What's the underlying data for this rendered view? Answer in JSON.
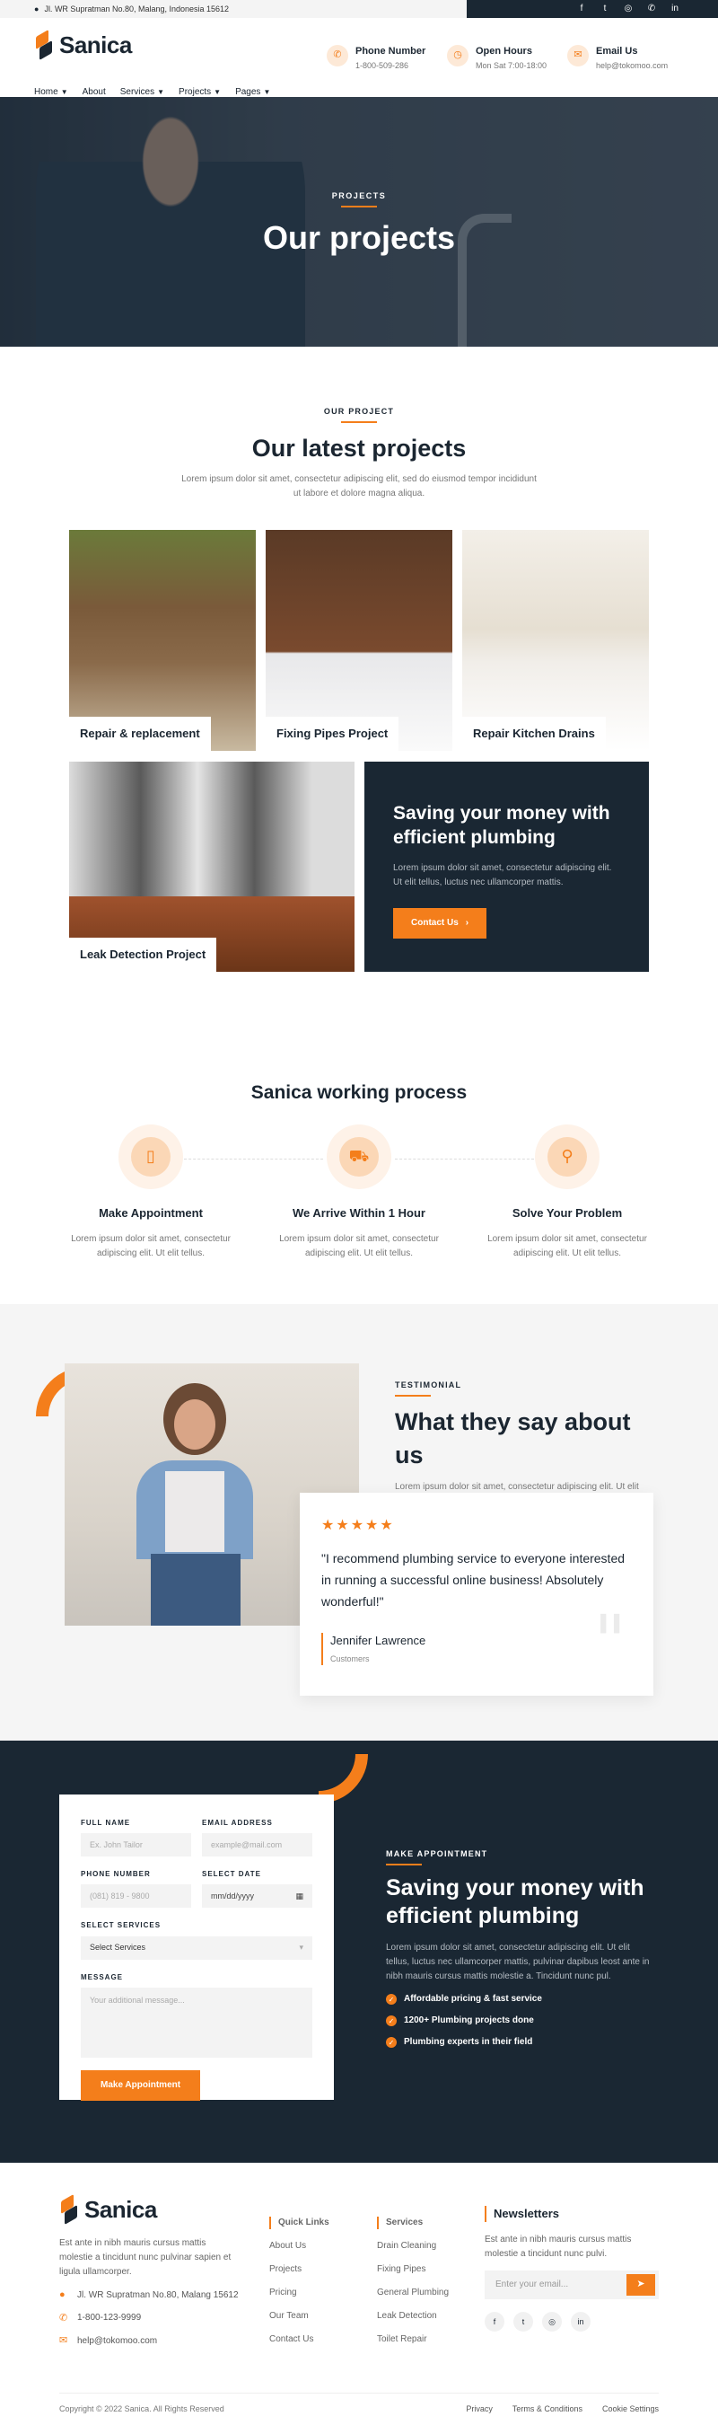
{
  "topbar": {
    "address": "Jl. WR Supratman No.80, Malang, Indonesia 15612"
  },
  "social": [
    "facebook-icon",
    "twitter-icon",
    "instagram-icon",
    "whatsapp-icon",
    "linkedin-icon"
  ],
  "brand": {
    "name": "Sanica",
    "accent": "#f47e1b",
    "dark": "#1a2733"
  },
  "nav": [
    "Home",
    "About",
    "Services",
    "Projects",
    "Pages"
  ],
  "header_info": [
    {
      "title": "Phone Number",
      "sub": "1-800-509-286"
    },
    {
      "title": "Open Hours",
      "sub": "Mon Sat 7:00-18:00"
    },
    {
      "title": "Email Us",
      "sub": "help@tokomoo.com"
    }
  ],
  "hero": {
    "label": "PROJECTS",
    "title": "Our projects"
  },
  "latest": {
    "kicker": "OUR PROJECT",
    "title": "Our latest projects",
    "desc": "Lorem ipsum dolor sit amet, consectetur adipiscing elit, sed do eiusmod tempor incididunt ut labore et dolore magna aliqua.",
    "projects": [
      "Repair & replacement",
      "Fixing Pipes Project",
      "Repair Kitchen Drains",
      "Leak Detection Project"
    ],
    "card": {
      "title": "Saving your money with efficient plumbing",
      "desc": "Lorem ipsum dolor sit amet, consectetur adipiscing elit. Ut elit tellus, luctus nec ullamcorper mattis.",
      "button": "Contact Us"
    }
  },
  "process": {
    "title": "Sanica working process",
    "steps": [
      {
        "title": "Make Appointment",
        "desc": "Lorem ipsum dolor sit amet, consectetur adipiscing elit. Ut elit tellus."
      },
      {
        "title": "We Arrive Within 1 Hour",
        "desc": "Lorem ipsum dolor sit amet, consectetur adipiscing elit. Ut elit tellus."
      },
      {
        "title": "Solve Your Problem",
        "desc": "Lorem ipsum dolor sit amet, consectetur adipiscing elit. Ut elit tellus."
      }
    ]
  },
  "testimonial": {
    "kicker": "TESTIMONIAL",
    "title": "What they say about us",
    "desc": "Lorem ipsum dolor sit amet, consectetur adipiscing elit. Ut elit tellus, luctus nec ullamcorper mattis, pulvinar dapibu.",
    "stars": "★★★★★",
    "quote": "\"I recommend plumbing service to everyone interested in running a successful online business! Absolutely wonderful!\"",
    "author": "Jennifer Lawrence",
    "role": "Customers"
  },
  "appointment": {
    "form": {
      "full_name_label": "FULL NAME",
      "full_name_ph": "Ex. John Tailor",
      "email_label": "EMAIL ADDRESS",
      "email_ph": "example@mail.com",
      "phone_label": "PHONE NUMBER",
      "phone_ph": "(081) 819 - 9800",
      "date_label": "SELECT DATE",
      "date_ph": "mm/dd/yyyy",
      "services_label": "SELECT SERVICES",
      "services_value": "Select Services",
      "message_label": "MESSAGE",
      "message_ph": "Your additional message...",
      "submit": "Make Appointment"
    },
    "kicker": "MAKE APPOINTMENT",
    "title": "Saving your money with efficient plumbing",
    "desc": "Lorem ipsum dolor sit amet, consectetur adipiscing elit. Ut elit tellus, luctus nec ullamcorper mattis, pulvinar dapibus leost ante in nibh mauris cursus mattis molestie a. Tincidunt nunc pul.",
    "bullets": [
      "Affordable pricing & fast service",
      "1200+ Plumbing projects done",
      "Plumbing experts in their field"
    ]
  },
  "footer": {
    "about": "Est ante in nibh mauris cursus mattis molestie a tincidunt nunc pulvinar sapien et ligula ullamcorper.",
    "address": "Jl. WR Supratman No.80, Malang 15612",
    "phone": "1-800-123-9999",
    "email": "help@tokomoo.com",
    "quick_title": "Quick Links",
    "quick": [
      "About Us",
      "Projects",
      "Pricing",
      "Our Team",
      "Contact Us"
    ],
    "services_title": "Services",
    "services": [
      "Drain Cleaning",
      "Fixing Pipes",
      "General Plumbing",
      "Leak Detection",
      "Toilet Repair"
    ],
    "news_title": "Newsletters",
    "news_desc": "Est ante in nibh mauris cursus mattis molestie a tincidunt nunc pulvi.",
    "news_ph": "Enter your email...",
    "copyright": "Copyright © 2022 Sanica. All Rights Reserved",
    "legal": [
      "Privacy",
      "Terms & Conditions",
      "Cookie Settings"
    ]
  }
}
